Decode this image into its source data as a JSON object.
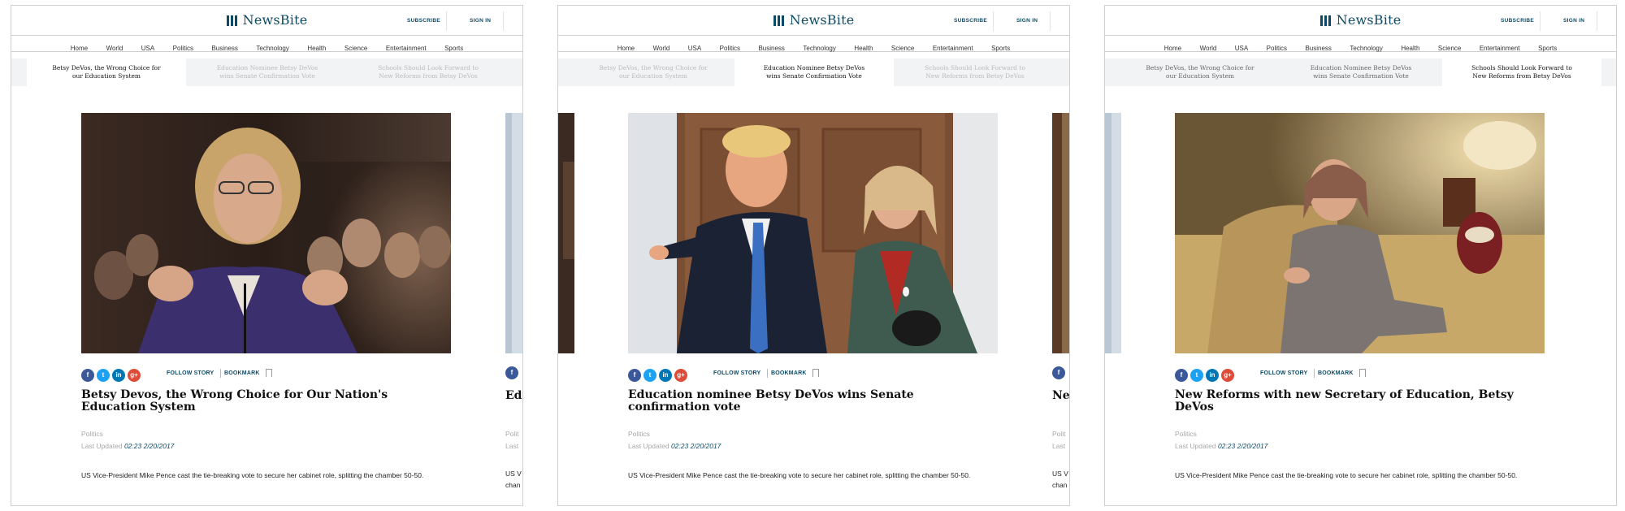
{
  "brand": {
    "name": "NewsBite",
    "subscribe": "SUBSCRIBE",
    "signin": "SIGN IN"
  },
  "nav": [
    "Home",
    "World",
    "USA",
    "Politics",
    "Business",
    "Technology",
    "Health",
    "Science",
    "Entertainment",
    "Sports"
  ],
  "tabs": [
    {
      "line1": "Betsy DeVos, the Wrong Choice for",
      "line2": "our Education System"
    },
    {
      "line1": "Education Nominee Betsy DeVos",
      "line2": "wins Senate Confirmation Vote"
    },
    {
      "line1": "Schools Should Look Forward to",
      "line2": "New Reforms from Betsy DeVos"
    }
  ],
  "actions": {
    "follow": "FOLLOW STORY",
    "bookmark": "BOOKMARK"
  },
  "social_icons": [
    "facebook-icon",
    "twitter-icon",
    "linkedin-icon",
    "google-plus-icon"
  ],
  "articles": [
    {
      "headline": "Betsy Devos, the Wrong Choice for Our Nation's Education System",
      "category": "Politics",
      "updated_label": "Last Updated",
      "updated_time": "02:23 2/20/2017",
      "summary": "US Vice-President Mike Pence cast the tie-breaking vote to secure her cabinet role, splitting the chamber 50-50."
    },
    {
      "headline": "Education nominee Betsy DeVos wins Senate confirmation vote",
      "category": "Politics",
      "updated_label": "Last Updated",
      "updated_time": "02:23 2/20/2017",
      "summary": "US Vice-President Mike Pence cast the tie-breaking vote to secure her cabinet role, splitting the chamber 50-50."
    },
    {
      "headline": "New Reforms with new Secretary of Education, Betsy DeVos",
      "category": "Politics",
      "updated_label": "Last Updated",
      "updated_time": "02:23 2/20/2017",
      "summary": "US Vice-President Mike Pence cast the tie-breaking vote to secure her cabinet role, splitting the chamber 50-50."
    }
  ],
  "peeks": {
    "frame1": {
      "head": "Edu",
      "cat": "Polit",
      "upd": "Last",
      "sum1": "US V",
      "sum2": "chan"
    },
    "frame2": {
      "head": "Nev",
      "cat": "Polit",
      "upd": "Last",
      "sum1": "US V",
      "sum2": "chan"
    }
  },
  "colors": {
    "brand": "#0d4a66",
    "tab_bg": "#f2f3f4",
    "facebook": "#3b5998",
    "twitter": "#1da1f2",
    "linkedin": "#0077b5",
    "google": "#dd4b39"
  }
}
